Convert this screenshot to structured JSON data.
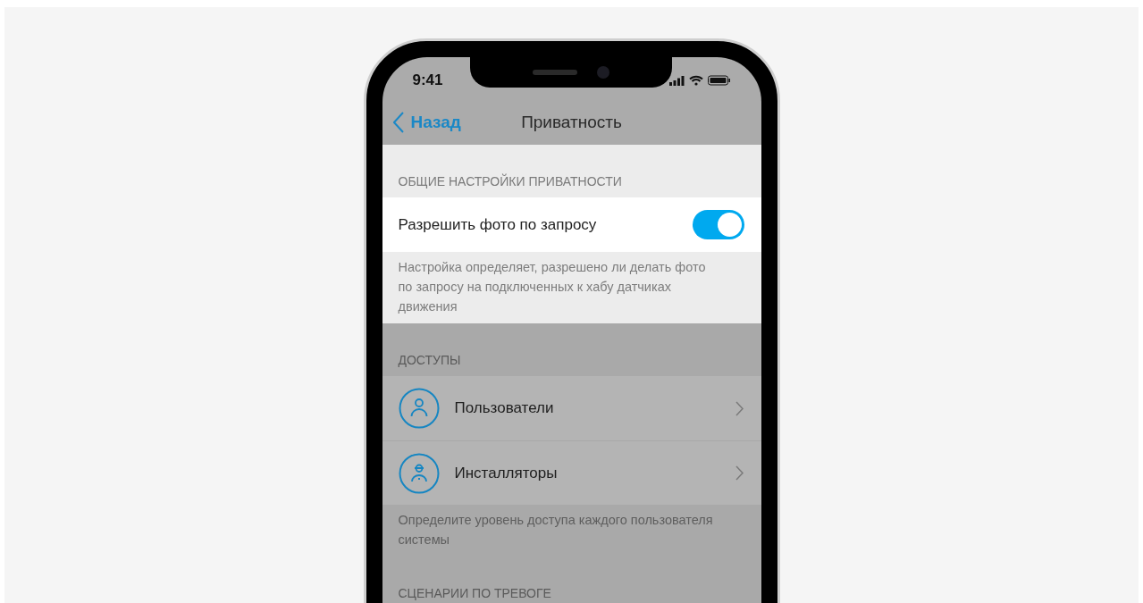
{
  "status_bar": {
    "time": "9:41"
  },
  "nav": {
    "back": "Назад",
    "title": "Приватность"
  },
  "sections": [
    {
      "header": "ОБЩИЕ НАСТРОЙКИ ПРИВАТНОСТИ",
      "highlighted": true,
      "rows": [
        {
          "kind": "toggle",
          "label": "Разрешить фото по запросу",
          "on": true
        }
      ],
      "footer": "Настройка определяет, разрешено ли делать фото по запросу на подключенных к хабу датчиках движения"
    },
    {
      "header": "ДОСТУПЫ",
      "highlighted": false,
      "rows": [
        {
          "kind": "link",
          "label": "Пользователи"
        },
        {
          "kind": "link",
          "label": "Инсталляторы"
        }
      ],
      "footer": "Определите уровень доступа каждого пользователя системы"
    },
    {
      "header": "СЦЕНАРИИ ПО ТРЕВОГЕ",
      "highlighted": false
    }
  ]
}
